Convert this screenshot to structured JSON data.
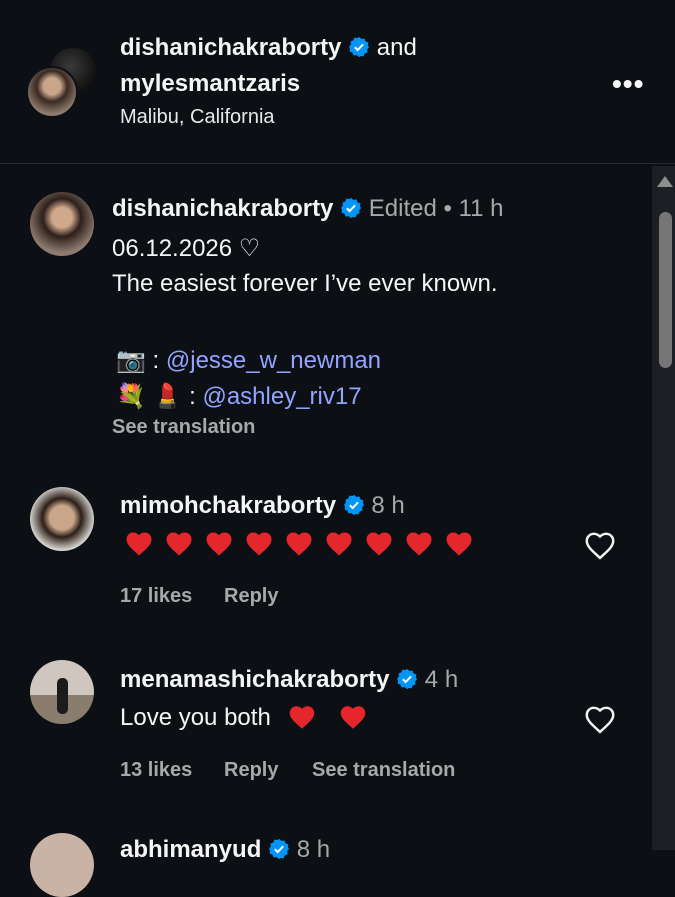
{
  "header": {
    "user1": "dishanichakraborty",
    "and_text": "and",
    "user2": "mylesmantzaris",
    "location": "Malibu, California",
    "more_icon": "more-horizontal-icon"
  },
  "caption": {
    "username": "dishanichakraborty",
    "edited": "Edited",
    "dot": "•",
    "time": "11 h",
    "date_line": "06.12.2026 ♡",
    "text": "The easiest forever I’ve ever known.",
    "photo_prefix": "📷 :",
    "photo_mention": "@jesse_w_newman",
    "mua_prefix": "💐 💄 :",
    "mua_mention": "@ashley_riv17",
    "see_translation": "See translation"
  },
  "comments": [
    {
      "username": "mimohchakraborty",
      "time": "8 h",
      "heart_count": 9,
      "likes": "17 likes",
      "reply": "Reply"
    },
    {
      "username": "menamashichakraborty",
      "time": "4 h",
      "text": "Love you both",
      "likes": "13 likes",
      "reply": "Reply",
      "see_translation": "See translation"
    },
    {
      "username": "abhimanyud",
      "time": "8 h"
    }
  ],
  "colors": {
    "background": "#0c1014",
    "verified": "#0095f6",
    "mention": "#93a4ff",
    "heart": "#e5262a"
  }
}
